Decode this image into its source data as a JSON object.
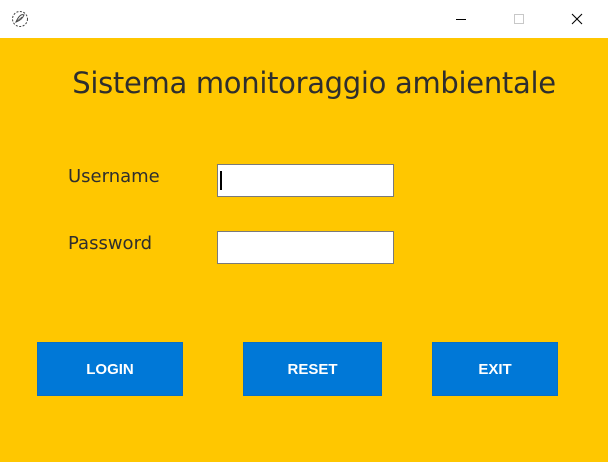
{
  "window": {
    "icon": "feather-icon",
    "controls": {
      "minimize_icon": "minimize-icon",
      "maximize_icon": "maximize-icon",
      "close_icon": "close-icon"
    }
  },
  "main": {
    "title": "Sistema monitoraggio ambientale",
    "username_label": "Username",
    "password_label": "Password",
    "username_value": "",
    "password_value": ""
  },
  "buttons": {
    "login": "LOGIN",
    "reset": "RESET",
    "exit": "EXIT"
  },
  "colors": {
    "background": "#ffc700",
    "button": "#0078d7",
    "button_text": "#ffffff",
    "text": "#2e2e2e"
  }
}
